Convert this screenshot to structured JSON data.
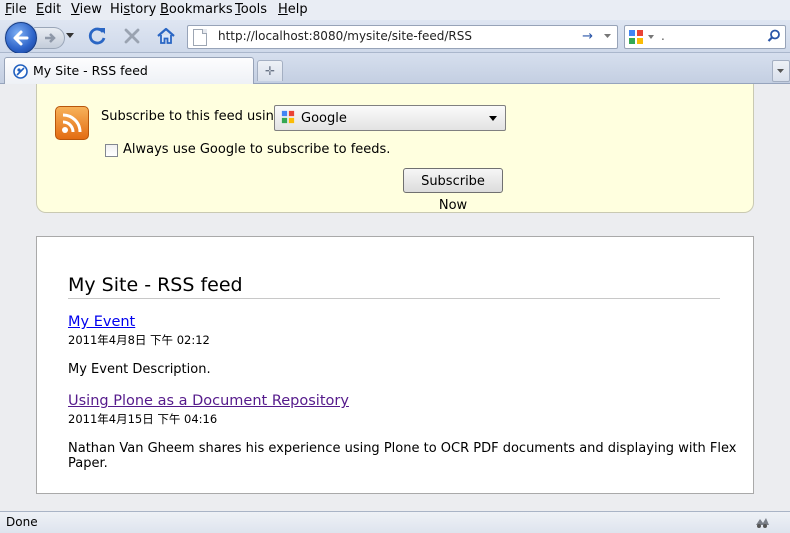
{
  "menu": [
    "File",
    "Edit",
    "View",
    "History",
    "Bookmarks",
    "Tools",
    "Help"
  ],
  "menu_access_keys": [
    "F",
    "E",
    "V",
    "s",
    "B",
    "T",
    "H"
  ],
  "nav": {
    "url": "http://localhost:8080/mysite/site-feed/RSS",
    "search_engine_icon": "google-icon",
    "search_value": "."
  },
  "tab": {
    "title": "My Site - RSS feed"
  },
  "subscribe": {
    "label": "Subscribe to this feed using",
    "reader": "Google",
    "always_label": "Always use Google to subscribe to feeds.",
    "always_checked": false,
    "button": "Subscribe Now"
  },
  "feed": {
    "title": "My Site - RSS feed",
    "entries": [
      {
        "title": "My Event",
        "date": "2011年4月8日 下午 02:12",
        "description": "My Event Description.",
        "visited": false
      },
      {
        "title": "Using Plone as a Document Repository",
        "date": "2011年4月15日 下午 04:16",
        "description": "Nathan Van Gheem shares his experience using Plone to OCR PDF documents and displaying with Flex Paper.",
        "visited": true
      }
    ]
  },
  "status": {
    "text": "Done"
  },
  "colors": {
    "link": "#0000ee",
    "visited_link": "#551a8b",
    "subscribe_bg": "#ffffdf",
    "rss_orange": "#e36c12"
  }
}
